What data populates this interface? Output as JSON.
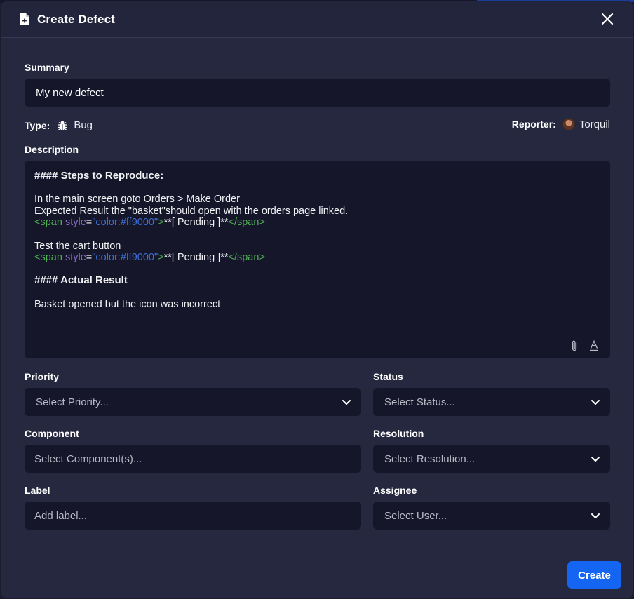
{
  "dialog": {
    "title": "Create Defect"
  },
  "summary": {
    "label": "Summary",
    "value": "My new defect"
  },
  "type": {
    "label": "Type:",
    "value": "Bug",
    "icon": "bug-icon"
  },
  "reporter": {
    "label": "Reporter:",
    "value": "Torquil"
  },
  "description": {
    "label": "Description",
    "heading1": "#### Steps to Reproduce:",
    "line1": "In the main screen goto Orders > Make Order",
    "line2": "Expected Result the \"basket\"should open with the orders page linked.",
    "span_open": "<span ",
    "span_attr": "style",
    "span_eq": "=",
    "span_value": "\"color:#ff9000\"",
    "span_close_bracket": ">",
    "pending_text": "**[ Pending ]**",
    "span_end": "</span>",
    "line3": "Test the cart button",
    "heading2": "#### Actual Result",
    "line4": "Basket opened but the icon was incorrect"
  },
  "priority": {
    "label": "Priority",
    "placeholder": "Select Priority..."
  },
  "status": {
    "label": "Status",
    "placeholder": "Select Status..."
  },
  "component": {
    "label": "Component",
    "placeholder": "Select Component(s)..."
  },
  "resolution": {
    "label": "Resolution",
    "placeholder": "Select Resolution..."
  },
  "label_field": {
    "label": "Label",
    "placeholder": "Add label..."
  },
  "assignee": {
    "label": "Assignee",
    "placeholder": "Select User..."
  },
  "actions": {
    "create": "Create"
  },
  "colors": {
    "accent": "#1466f2",
    "panel": "#262840",
    "input_bg": "#15162a",
    "html_tag": "#4caf50",
    "html_attr": "#8e6fc0",
    "html_string": "#3d6fd8"
  }
}
